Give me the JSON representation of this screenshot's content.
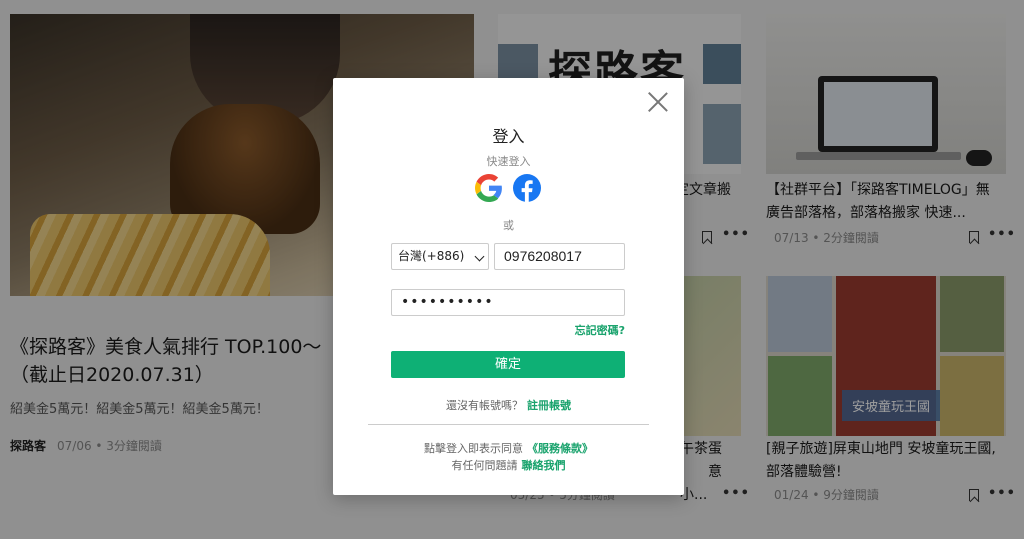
{
  "background": {
    "hero": {
      "title": "《探路客》美食人氣排行 TOP.100～（截止日2020.07.31）",
      "desc": "紹美金5萬元！紹美金5萬元！紹美金5萬元！",
      "author": "探路客",
      "meta": "07/06 • 3分鐘閱讀"
    },
    "card_b": {
      "logo": "探路客",
      "title": "定文章搬"
    },
    "card_c": {
      "title": "【社群平台】「探路客TIMELOG」無廣告部落格，部落格搬家 快速...",
      "meta": "07/13 • 2分鐘閱讀"
    },
    "card_d": {
      "title": "午茶蛋 　　意小...",
      "meta": "05/25 • 5分鐘閱讀"
    },
    "card_e": {
      "tag": "安坡童玩王國",
      "title": "[親子旅遊]屏東山地門 安坡童玩王國,部落體驗營!",
      "meta": "01/24 • 9分鐘閱讀"
    }
  },
  "modal": {
    "title": "登入",
    "quick_login": "快速登入",
    "or": "或",
    "country": "台灣(+886)",
    "phone": "0976208017",
    "password": "••••••••••",
    "forgot": "忘記密碼?",
    "submit": "確定",
    "no_account": "還沒有帳號嗎？",
    "register": "註冊帳號",
    "agree": "點擊登入即表示同意",
    "terms": "《服務條款》",
    "questions": "有任何問題請",
    "contact": "聯絡我們"
  },
  "colors": {
    "accent": "#0eb075",
    "link": "#1aa36d",
    "facebook": "#1877f2"
  }
}
